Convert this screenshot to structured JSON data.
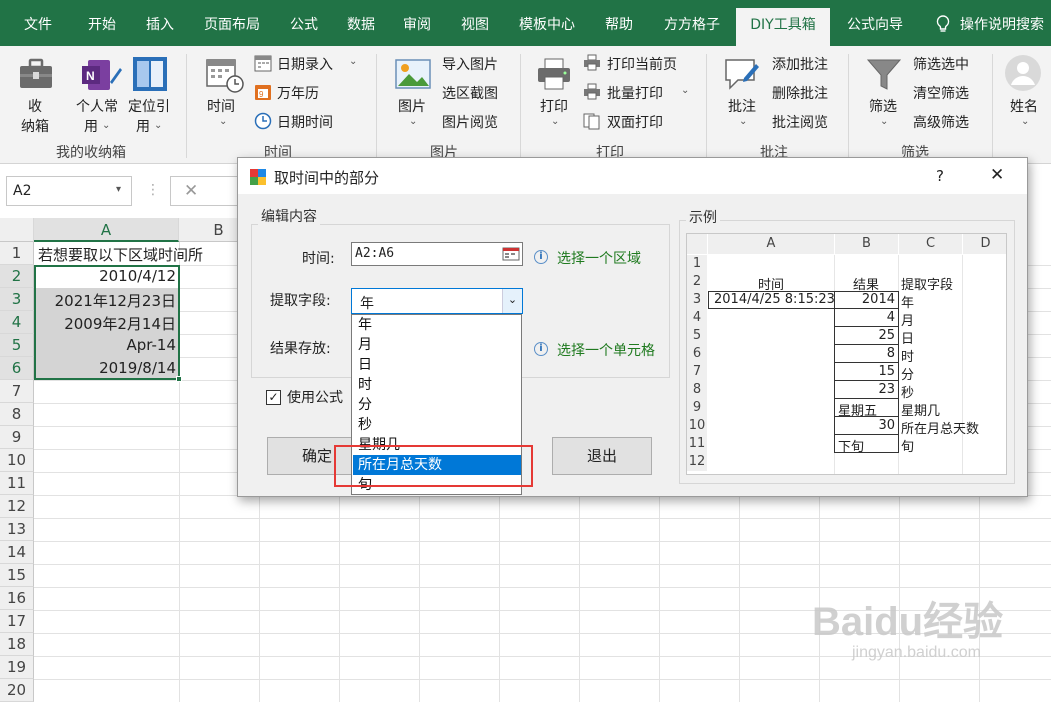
{
  "tabs": [
    "文件",
    "开始",
    "插入",
    "页面布局",
    "公式",
    "数据",
    "审阅",
    "视图",
    "模板中心",
    "帮助",
    "方方格子",
    "DIY工具箱",
    "公式向导",
    "操作说明搜索"
  ],
  "ribbon": {
    "collect": {
      "label1": "收",
      "label2": "纳箱"
    },
    "personal": {
      "label1": "个人常",
      "label2": "用"
    },
    "locate": {
      "label1": "定位引",
      "label2": "用"
    },
    "group_storage": "我的收纳箱",
    "time_btn": "时间",
    "date_entry": "日期录入",
    "calendar": "万年历",
    "datetime": "日期时间",
    "group_time": "时间",
    "picture_btn": "图片",
    "import_pic": "导入图片",
    "area_shot": "选区截图",
    "pic_view": "图片阅览",
    "group_picture": "图片",
    "print_btn": "打印",
    "print_page": "打印当前页",
    "batch_print": "批量打印",
    "duplex_print": "双面打印",
    "group_print": "打印",
    "comment_btn": "批注",
    "add_comment": "添加批注",
    "del_comment": "删除批注",
    "view_comment": "批注阅览",
    "group_comment": "批注",
    "filter_btn": "筛选",
    "filter_sel": "筛选选中",
    "clear_filter": "清空筛选",
    "adv_filter": "高级筛选",
    "group_filter": "筛选",
    "name_btn": "姓名"
  },
  "formula_bar": {
    "namebox": "A2"
  },
  "grid": {
    "columns": [
      "A",
      "B"
    ],
    "rows": [
      "1",
      "2",
      "3",
      "4",
      "5",
      "6",
      "7",
      "8",
      "9",
      "10",
      "11",
      "12",
      "13",
      "14",
      "15",
      "16",
      "17",
      "18",
      "19",
      "20"
    ],
    "a1": "若想要取以下区域时间所",
    "a2": "2010/4/12",
    "a3": "2021年12月23日",
    "a4": "2009年2月14日",
    "a5": "Apr-14",
    "a6": "2019/8/14"
  },
  "dialog": {
    "title": "取时间中的部分",
    "help": "?",
    "close": "✕",
    "edit_group": "编辑内容",
    "time_label": "时间:",
    "time_value": "A2:A6",
    "select_region": "选择一个区域",
    "field_label": "提取字段:",
    "field_value": "年",
    "result_label": "结果存放:",
    "select_cell": "选择一个单元格",
    "use_formula": "使用公式",
    "ok": "确定",
    "exit": "退出",
    "example_group": "示例",
    "options": [
      "年",
      "月",
      "日",
      "时",
      "分",
      "秒",
      "星期几",
      "所在月总天数",
      "旬"
    ],
    "selected_index": 7
  },
  "example": {
    "cols": [
      "A",
      "B",
      "C",
      "D"
    ],
    "rows": [
      "1",
      "2",
      "3",
      "4",
      "5",
      "6",
      "7",
      "8",
      "9",
      "10",
      "11",
      "12"
    ],
    "h_time": "时间",
    "h_result": "结果",
    "h_field": "提取字段",
    "time_value": "2014/4/25 8:15:23",
    "results": [
      "2014",
      "4",
      "25",
      "8",
      "15",
      "23",
      "星期五",
      "30",
      "下旬"
    ],
    "fields": [
      "年",
      "月",
      "日",
      "时",
      "分",
      "秒",
      "星期几",
      "所在月总天数",
      "旬"
    ]
  },
  "watermark": {
    "main": "Baidu经验",
    "sub": "jingyan.baidu.com"
  },
  "colors": {
    "ribbon_green": "#217346",
    "select_blue": "#0078d7",
    "highlight_red": "#e53935"
  }
}
